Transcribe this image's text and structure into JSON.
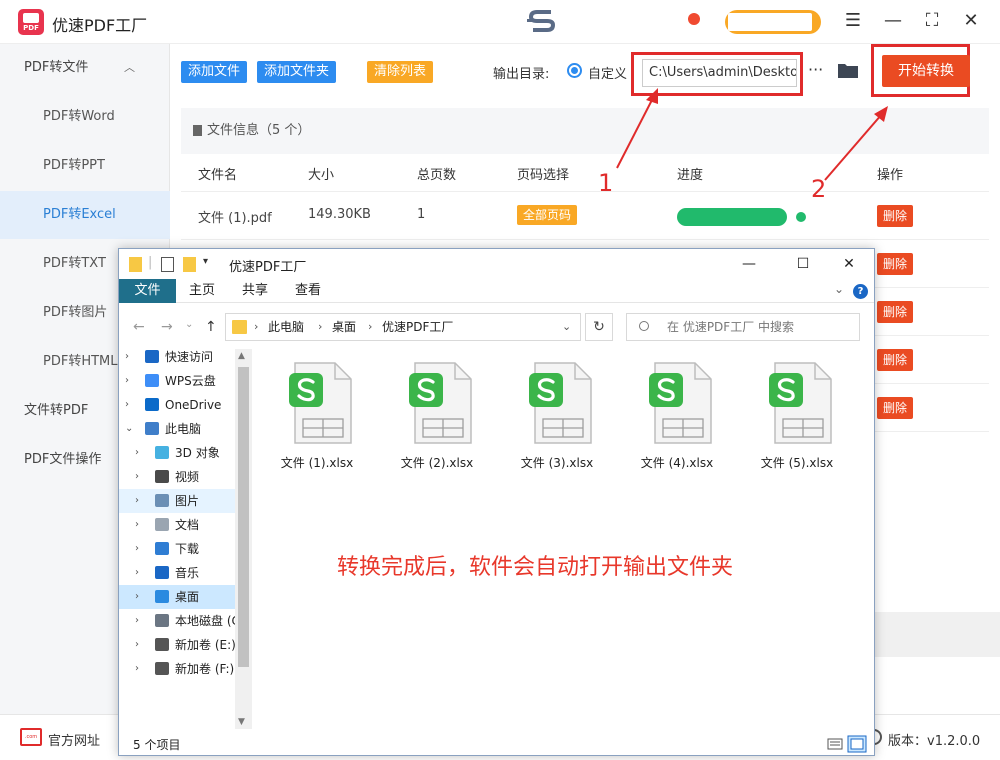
{
  "app": {
    "title": "优速PDF工厂",
    "logo_text": "PDF",
    "window_controls": [
      "menu-icon",
      "minimize-icon",
      "fullscreen-icon",
      "close-icon"
    ]
  },
  "sidebar": {
    "items": [
      {
        "label": "PDF转文件",
        "kind": "top"
      },
      {
        "label": "PDF转Word",
        "kind": "sub"
      },
      {
        "label": "PDF转PPT",
        "kind": "sub"
      },
      {
        "label": "PDF转Excel",
        "kind": "sub",
        "active": true
      },
      {
        "label": "PDF转TXT",
        "kind": "sub"
      },
      {
        "label": "PDF转图片",
        "kind": "sub"
      },
      {
        "label": "PDF转HTML",
        "kind": "sub"
      },
      {
        "label": "文件转PDF",
        "kind": "top"
      },
      {
        "label": "PDF文件操作",
        "kind": "top"
      }
    ]
  },
  "toolbar": {
    "add_file": "添加文件",
    "add_folder": "添加文件夹",
    "clear_list": "清除列表",
    "output_label": "输出目录:",
    "custom_label": "自定义",
    "path_value": "C:\\Users\\admin\\Desktop",
    "more": "···",
    "start": "开始转换"
  },
  "table": {
    "info": "文件信息（5 个）",
    "headers": {
      "name": "文件名",
      "size": "大小",
      "pages": "总页数",
      "page_select": "页码选择",
      "progress": "进度",
      "action": "操作"
    },
    "rows": [
      {
        "name": "文件 (1).pdf",
        "size": "149.30KB",
        "pages": "1",
        "page_select": "全部页码",
        "progress": 1.0,
        "action": "删除"
      },
      {
        "action": "删除"
      },
      {
        "action": "删除"
      },
      {
        "action": "删除"
      },
      {
        "action": "删除"
      }
    ]
  },
  "annotations": {
    "one": "1",
    "two": "2",
    "color": "#e02b2b"
  },
  "explorer": {
    "title": "优速PDF工厂",
    "ribbon": {
      "file": "文件",
      "home": "主页",
      "share": "共享",
      "view": "查看"
    },
    "breadcrumb": [
      "此电脑",
      "桌面",
      "优速PDF工厂"
    ],
    "search_placeholder": "在 优速PDF工厂 中搜索",
    "tree": [
      {
        "label": "快速访问",
        "icon": "star-icon",
        "level": 0,
        "arrow": "›"
      },
      {
        "label": "WPS云盘",
        "icon": "cloud-icon",
        "level": 0,
        "arrow": "›"
      },
      {
        "label": "OneDrive",
        "icon": "onedrive-icon",
        "level": 0,
        "arrow": "›"
      },
      {
        "label": "此电脑",
        "icon": "computer-icon",
        "level": 0,
        "arrow": "⌄"
      },
      {
        "label": "3D 对象",
        "icon": "cube-icon",
        "level": 1,
        "arrow": "›"
      },
      {
        "label": "视频",
        "icon": "video-icon",
        "level": 1,
        "arrow": "›"
      },
      {
        "label": "图片",
        "icon": "picture-icon",
        "level": 1,
        "arrow": "›",
        "hover": true
      },
      {
        "label": "文档",
        "icon": "document-icon",
        "level": 1,
        "arrow": "›"
      },
      {
        "label": "下载",
        "icon": "download-icon",
        "level": 1,
        "arrow": "›"
      },
      {
        "label": "音乐",
        "icon": "music-icon",
        "level": 1,
        "arrow": "›"
      },
      {
        "label": "桌面",
        "icon": "desktop-icon",
        "level": 1,
        "arrow": "›",
        "selected": true
      },
      {
        "label": "本地磁盘 (C:)",
        "icon": "disk-icon",
        "level": 1,
        "arrow": "›"
      },
      {
        "label": "新加卷 (E:)",
        "icon": "drive-icon",
        "level": 1,
        "arrow": "›"
      },
      {
        "label": "新加卷 (F:)",
        "icon": "drive-icon",
        "level": 1,
        "arrow": "›"
      }
    ],
    "files": [
      "文件 (1).xlsx",
      "文件 (2).xlsx",
      "文件 (3).xlsx",
      "文件 (4).xlsx",
      "文件 (5).xlsx"
    ],
    "message": "转换完成后，软件会自动打开输出文件夹",
    "status": "5 个项目"
  },
  "footer": {
    "site_icon_text": ".com",
    "site_link": "官方网址",
    "version": "版本：v1.2.0.0"
  },
  "colors": {
    "blue": "#2d8cf0",
    "orange": "#f9a825",
    "red_button": "#ea4b22",
    "progress_green": "#21ba6c",
    "excel_green": "#3bb54a",
    "message_red": "#e8382b"
  }
}
